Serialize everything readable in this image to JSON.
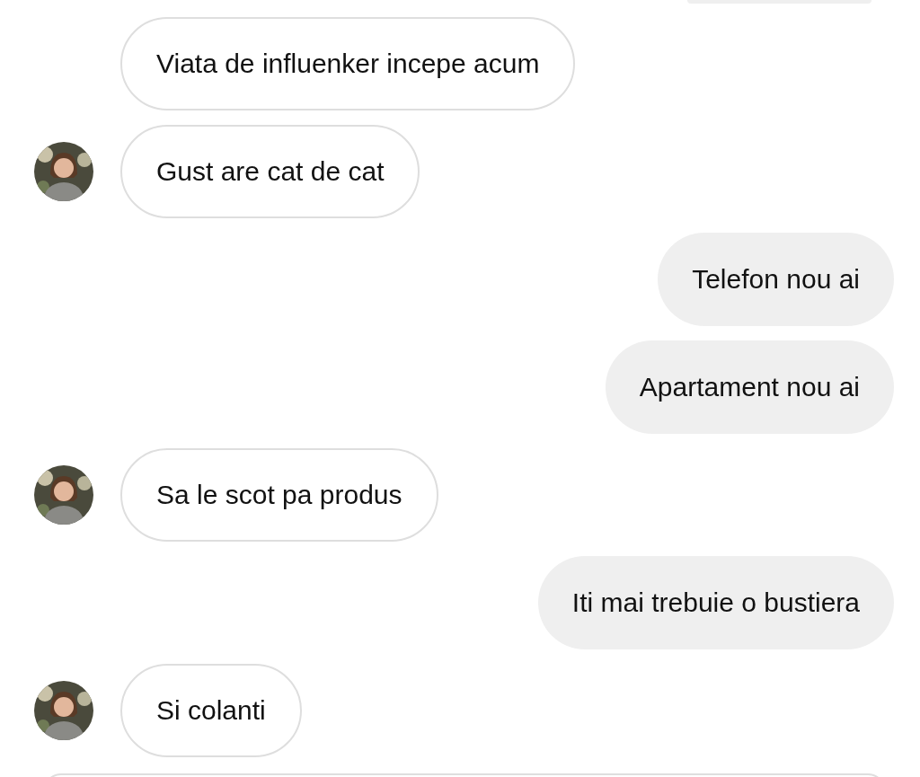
{
  "messages": [
    {
      "text": "Viata de influenker incepe acum",
      "kind": "received",
      "avatar": false
    },
    {
      "text": "Gust are cat de cat",
      "kind": "received",
      "avatar": true
    },
    {
      "text": "Telefon nou ai",
      "kind": "sent"
    },
    {
      "text": "Apartament nou ai",
      "kind": "sent"
    },
    {
      "text": "Sa le scot pa produs",
      "kind": "received",
      "avatar": true
    },
    {
      "text": "Iti mai trebuie o bustiera",
      "kind": "sent"
    },
    {
      "text": "Si colanti",
      "kind": "received",
      "avatar": true
    }
  ]
}
